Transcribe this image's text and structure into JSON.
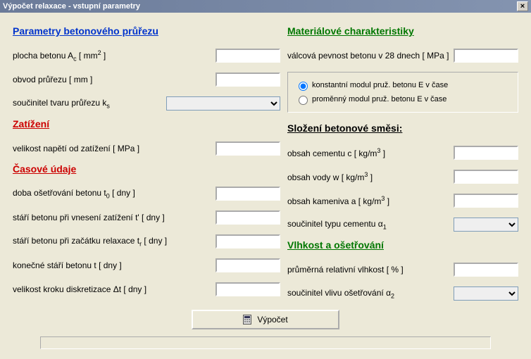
{
  "window": {
    "title": "Výpočet relaxace - vstupní parametry"
  },
  "left": {
    "sec1": {
      "heading": "Parametry betonového průřezu"
    },
    "area": {
      "label_pre": "plocha betonu A",
      "sub": "c",
      "label_post": " [ mm",
      "sup": "2",
      "label_end": " ]",
      "value": ""
    },
    "perim": {
      "label": "obvod průřezu [ mm ]",
      "value": ""
    },
    "shape": {
      "label_pre": "součinitel tvaru průřezu k",
      "sub": "s",
      "value": ""
    },
    "sec2": {
      "heading": "Zatížení"
    },
    "stress": {
      "label": "velikost napětí od zatížení [ MPa ]",
      "value": ""
    },
    "sec3": {
      "heading": "Časové údaje"
    },
    "cure": {
      "label_pre": "doba ošetřování betonu t",
      "sub": "0",
      "label_post": " [ dny ]",
      "value": ""
    },
    "ageLoad": {
      "label": "stáří betonu při vnesení zatížení t' [ dny ]",
      "value": ""
    },
    "ageRelax": {
      "label_pre": "stáří betonu při začátku relaxace t",
      "sub": "r",
      "label_post": " [ dny ]",
      "value": ""
    },
    "ageEnd": {
      "label": "konečné stáří betonu t [ dny ]",
      "value": ""
    },
    "step": {
      "label": "velikost kroku diskretizace Δt [ dny ]",
      "value": ""
    }
  },
  "right": {
    "sec1": {
      "heading": "Materiálové charakteristiky"
    },
    "fck": {
      "label": "válcová pevnost betonu v 28 dnech [ MPa ]",
      "value": ""
    },
    "modulus": {
      "opt1": "konstantní modul pruž. betonu E v čase",
      "opt2": "proměnný modul pruž. betonu E v čase",
      "selected": "1"
    },
    "sec2": {
      "heading": "Složení betonové směsi:"
    },
    "cement": {
      "label_pre": "obsah cementu c [ kg/m",
      "sup": "3",
      "label_post": " ]",
      "value": ""
    },
    "water": {
      "label_pre": "obsah vody w [ kg/m",
      "sup": "3",
      "label_post": " ]",
      "value": ""
    },
    "aggr": {
      "label_pre": "obsah kameniva a [ kg/m",
      "sup": "3",
      "label_post": " ]",
      "value": ""
    },
    "cemType": {
      "label_pre": "součinitel typu cementu α",
      "sub": "1",
      "value": ""
    },
    "sec3": {
      "heading": "Vlhkost a ošetřování"
    },
    "rh": {
      "label": "průměrná relativní vlhkost [ % ]",
      "value": ""
    },
    "careCoef": {
      "label_pre": "součinitel vlivu ošetřování  α",
      "sub": "2",
      "value": ""
    }
  },
  "footer": {
    "button": "Výpočet"
  }
}
